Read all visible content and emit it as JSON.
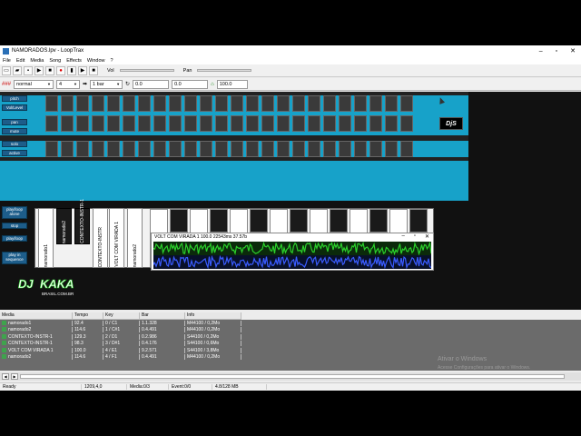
{
  "window": {
    "title": "NAMORADOS.lpv - LoopTrax",
    "controls": [
      "–",
      "▫",
      "✕"
    ]
  },
  "menu": [
    "File",
    "Edit",
    "Media",
    "Song",
    "Effects",
    "Window",
    "?"
  ],
  "toolbar": {
    "vol_label": "Vol",
    "pan_label": "Pan"
  },
  "toolbar2": {
    "mode": "normal",
    "beats": "4",
    "length": "1 bar",
    "value_a": "0.0",
    "value_b": "0.0",
    "tempo": "100.0"
  },
  "mixer": {
    "labels": {
      "pitch": "pitch",
      "volume": "Vol/Level",
      "pan": "pan",
      "mute": "mute",
      "solo": "solo",
      "active": "active"
    },
    "brand": "DjS"
  },
  "side_buttons": [
    "play/loop alone",
    "stop",
    "play/loop",
    "play in sequence"
  ],
  "pads": [
    {
      "label": "namorado1",
      "black": false
    },
    {
      "label": "namorado2",
      "black": true
    },
    {
      "label": "CONTEXTO-INSTR-1",
      "black": true
    },
    {
      "label": "CONTEXTO-INSTR",
      "black": false
    },
    {
      "label": "VOLT COM VIRADA 1",
      "black": false
    },
    {
      "label": "namorado2",
      "black": false
    }
  ],
  "wave_window": {
    "title": "VOLT COM VIRADA 1 100.0 22543ms 37.57b",
    "controls": [
      "–",
      "▫",
      "✕"
    ]
  },
  "logo": {
    "line1": "DJ",
    "line2": "KAKA",
    "line3": "BRASIL.COM.BR"
  },
  "media_list": {
    "columns": [
      "Media",
      "Tempo",
      "Key",
      "Bar",
      "Info"
    ],
    "rows": [
      [
        "namorado1",
        "92.4",
        "0 / C1",
        "1.1.328",
        "M44100 / 0,2Mo"
      ],
      [
        "namorado2",
        "114.6",
        "1 / C#1",
        "0.4.491",
        "M44100 / 0,2Mo"
      ],
      [
        "CONTEXTO-INSTR-1",
        "129.3",
        "2 / D1",
        "0.2.986",
        "S44100 / 0,2Mo"
      ],
      [
        "CONTEXTO-INSTR-1",
        "98.3",
        "3 / D#1",
        "0.4.176",
        "S44100 / 0,6Mo"
      ],
      [
        "VOLT COM VIRADA 1",
        "100.0",
        "4 / E1",
        "9.2.571",
        "S44100 / 3,8Mo"
      ],
      [
        "namorado2",
        "114.6",
        "4 / F1",
        "0.4.491",
        "M44100 / 0,2Mo"
      ]
    ]
  },
  "statusbar": [
    "Ready",
    "1209,4,0",
    "Media:0/3",
    "Event:0/0",
    "4.8/128 MB"
  ],
  "watermark": {
    "title": "Ativar o Windows",
    "subtitle": "Acesse Configurações para ativar o Windows."
  },
  "colors": {
    "mixer_bg": "#17a2c9",
    "list_bg": "#6b6b6b",
    "wave_green": "#2bd12b",
    "wave_blue": "#2b4dff"
  }
}
